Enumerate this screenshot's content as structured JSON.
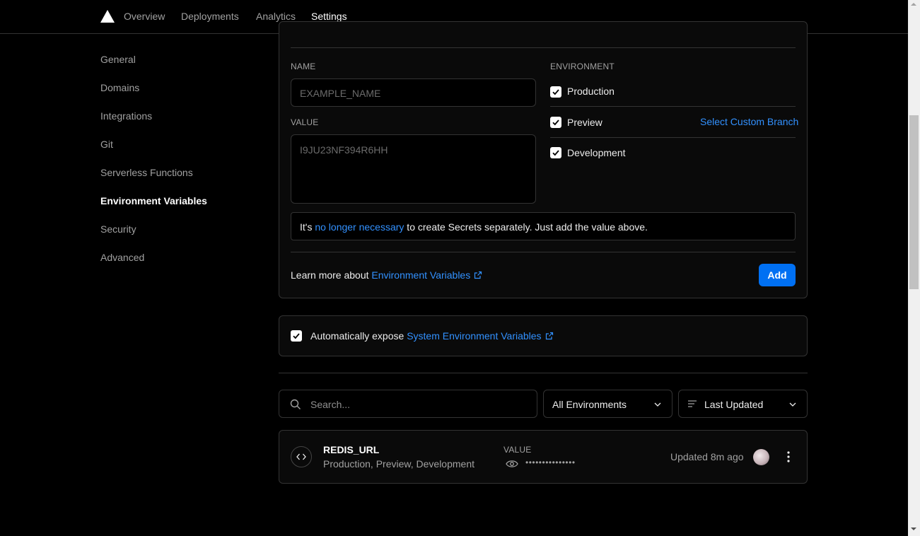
{
  "nav": {
    "logo_icon": "triangle-logo-icon",
    "tabs": [
      {
        "label": "Overview"
      },
      {
        "label": "Deployments"
      },
      {
        "label": "Analytics"
      },
      {
        "label": "Settings",
        "active": true
      }
    ]
  },
  "sidebar": {
    "items": [
      {
        "label": "General"
      },
      {
        "label": "Domains"
      },
      {
        "label": "Integrations"
      },
      {
        "label": "Git"
      },
      {
        "label": "Serverless Functions"
      },
      {
        "label": "Environment Variables",
        "active": true
      },
      {
        "label": "Security"
      },
      {
        "label": "Advanced"
      }
    ]
  },
  "form": {
    "name_label": "NAME",
    "name_placeholder": "EXAMPLE_NAME",
    "value_label": "VALUE",
    "value_placeholder": "I9JU23NF394R6HH",
    "environment_label": "ENVIRONMENT",
    "environments": [
      {
        "label": "Production",
        "checked": true
      },
      {
        "label": "Preview",
        "checked": true
      },
      {
        "label": "Development",
        "checked": true
      }
    ],
    "select_branch_link": "Select Custom Branch",
    "notice": {
      "before": "It's ",
      "link": "no longer necessary",
      "after": " to create Secrets separately. Just add the value above."
    },
    "learn_more_prefix": "Learn more about ",
    "learn_more_link": "Environment Variables",
    "add_button": "Add"
  },
  "auto_expose": {
    "checked": true,
    "prefix": "Automatically expose ",
    "link": "System Environment Variables"
  },
  "filters": {
    "search_placeholder": "Search...",
    "environment_select": "All Environments",
    "sort_select": "Last Updated"
  },
  "variables": [
    {
      "name": "REDIS_URL",
      "environments": "Production, Preview, Development",
      "value_label": "VALUE",
      "masked_value": "•••••••••••••••",
      "updated": "Updated 8m ago"
    }
  ],
  "colors": {
    "accent_link": "#3291ff",
    "primary_button": "#0070f3",
    "background": "#000000",
    "border": "#333333"
  }
}
